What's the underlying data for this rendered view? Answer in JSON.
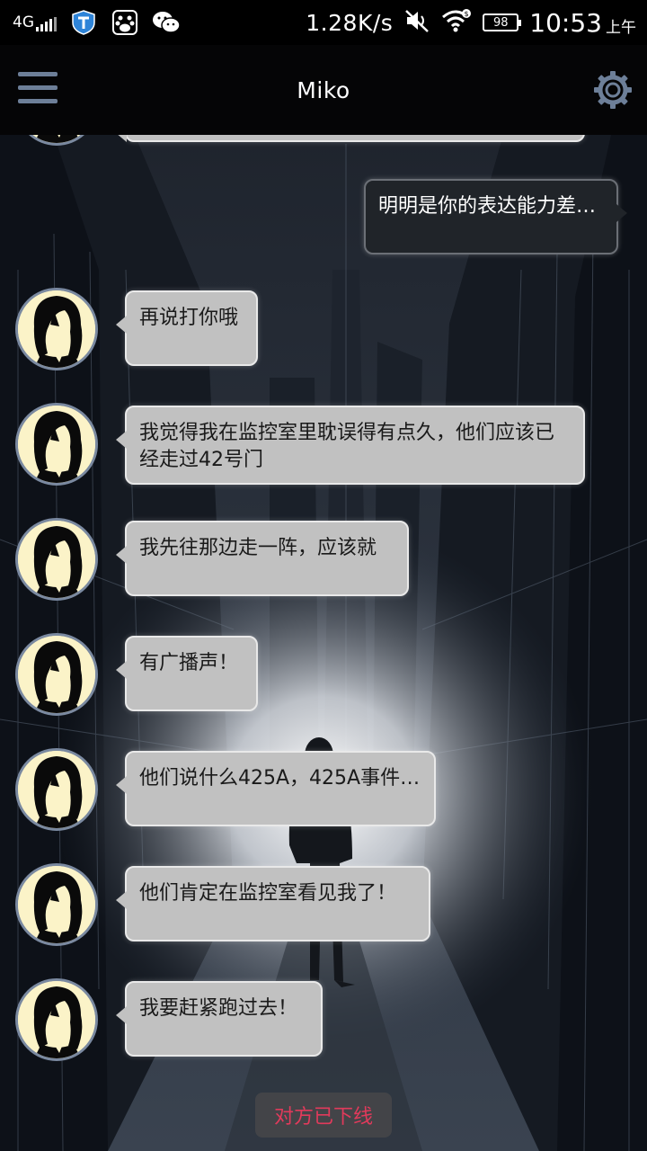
{
  "status_bar": {
    "network": "4G",
    "speed": "1.28K/s",
    "battery": "98",
    "time": "10:53",
    "am_pm": "上午",
    "icons": [
      "signal-icon",
      "shield-app-icon",
      "baidu-app-icon",
      "wechat-app-icon",
      "mute-icon",
      "wifi-icon",
      "battery-icon"
    ]
  },
  "header": {
    "title": "Miko",
    "menu_icon": "hamburger-menu-icon",
    "settings_icon": "gear-icon"
  },
  "messages": [
    {
      "side": "in",
      "text": ""
    },
    {
      "side": "out",
      "text": "明明是你的表达能力差…"
    },
    {
      "side": "in",
      "text": "再说打你哦"
    },
    {
      "side": "in",
      "text": "我觉得我在监控室里耽误得有点久，他们应该已经走过42号门"
    },
    {
      "side": "in",
      "text": "我先往那边走一阵，应该就"
    },
    {
      "side": "in",
      "text": "有广播声！"
    },
    {
      "side": "in",
      "text": "他们说什么425A，425A事件…"
    },
    {
      "side": "in",
      "text": "他们肯定在监控室看见我了！"
    },
    {
      "side": "in",
      "text": "我要赶紧跑过去！"
    }
  ],
  "footer": {
    "status_text": "对方已下线"
  },
  "colors": {
    "incoming_bubble": "#c1c1c1",
    "outgoing_bubble": "#202429",
    "offline_text": "#e13a5b",
    "icon_accent": "#6d7f98"
  }
}
